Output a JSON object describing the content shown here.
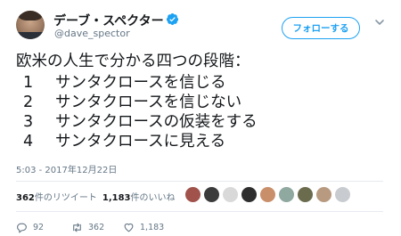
{
  "user": {
    "display_name": "デーブ・スペクター",
    "handle": "@dave_spector",
    "verified": true
  },
  "follow_button": {
    "label": "フォローする"
  },
  "tweet": {
    "intro": "欧米の人生で分かる四つの段階：",
    "stages": [
      {
        "num": "1",
        "text": "サンタクロースを信じる"
      },
      {
        "num": "2",
        "text": "サンタクロースを信じない"
      },
      {
        "num": "3",
        "text": "サンタクロースの仮装をする"
      },
      {
        "num": "4",
        "text": "サンタクロースに見える"
      }
    ],
    "timestamp": "5:03 - 2017年12月22日"
  },
  "stats": {
    "retweets_count": "362",
    "retweets_label": "件のリツイート",
    "likes_count": "1,183",
    "likes_label": "件のいいね"
  },
  "likers": [
    {
      "icon": "liker-avatar-1",
      "color": "#a0524b"
    },
    {
      "icon": "liker-avatar-2",
      "color": "#3b3b3b"
    },
    {
      "icon": "liker-avatar-3",
      "color": "#d9d9d9"
    },
    {
      "icon": "liker-avatar-4",
      "color": "#2e2e2e"
    },
    {
      "icon": "liker-avatar-5",
      "color": "#c98f6b"
    },
    {
      "icon": "liker-avatar-6",
      "color": "#8fa8a0"
    },
    {
      "icon": "liker-avatar-7",
      "color": "#6b6b4e"
    },
    {
      "icon": "liker-avatar-8",
      "color": "#b89a80"
    },
    {
      "icon": "liker-avatar-9",
      "color": "#c8ccd0"
    }
  ],
  "actions": {
    "reply_count": "92",
    "retweet_count": "362",
    "like_count": "1,183"
  },
  "colors": {
    "accent": "#1da1f2",
    "text": "#14171a",
    "muted": "#657786",
    "divider": "#e6ecf0"
  }
}
